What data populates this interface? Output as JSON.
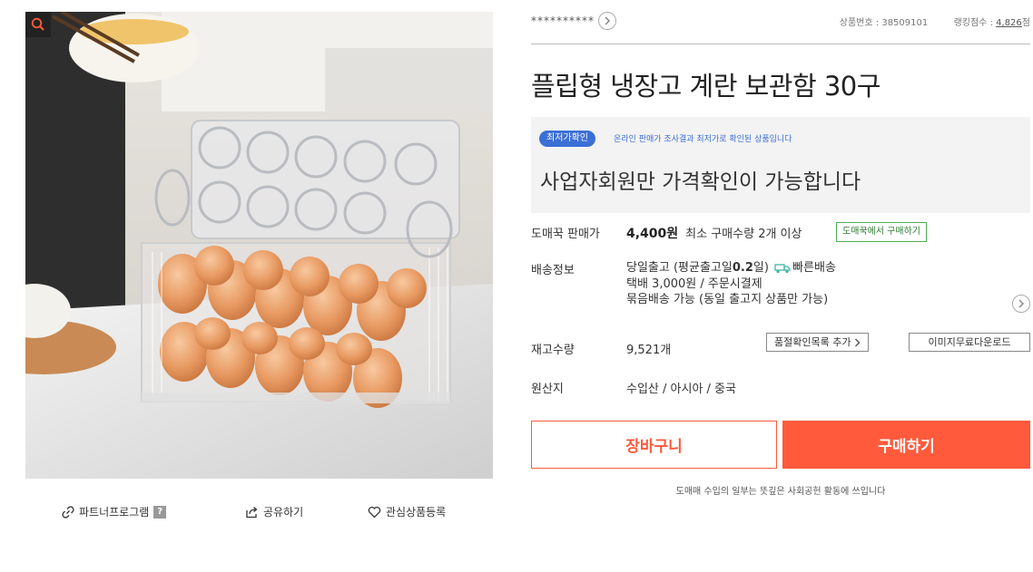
{
  "image": {
    "zoom_icon": "search-icon"
  },
  "image_actions": {
    "partner_label": "파트너프로그램",
    "partner_help": "?",
    "share_label": "공유하기",
    "wish_label": "관심상품등록"
  },
  "header": {
    "seller_name": "**********",
    "product_no_label": "상품번호 :",
    "product_no": "38509101",
    "ranking_label": "랭킹점수 :",
    "ranking_value": "4,826",
    "ranking_unit": "점"
  },
  "product": {
    "title": "플립형 냉장고 계란 보관함 30구"
  },
  "price_box": {
    "badge": "최저가확인",
    "note": "온라인 판매가 조사결과 최저가로 확인된 상품입니다",
    "business_only": "사업자회원만 가격확인이 가능합니다"
  },
  "details": {
    "wholesale_label": "도매꾹 판매가",
    "wholesale_price": "4,400원",
    "min_qty": "최소 구매수량 2개 이상",
    "buy_on_domeggook": "도매꾹에서 구매하기",
    "shipping_label": "배송정보",
    "shipping_line1_a": "당일출고 (평균출고일",
    "shipping_line1_b": "0.2",
    "shipping_line1_c": "일)",
    "shipping_fast": "빠른배송",
    "shipping_line2": "택배 3,000원 / 주문시결제",
    "shipping_line3": "묶음배송 가능 (동일 출고지 상품만 가능)",
    "stock_label": "재고수량",
    "stock_value": "9,521개",
    "soldout_button": "품절확인목록 추가",
    "image_download_button": "이미지무료다운로드",
    "origin_label": "원산지",
    "origin_value": "수입산 / 아시아 / 중국"
  },
  "actions": {
    "cart": "장바구니",
    "buy": "구매하기",
    "footnote": "도매매 수입의 일부는 뜻깊은 사회공헌 활동에 쓰입니다"
  },
  "colors": {
    "accent": "#ff5a3c",
    "badge_blue": "#3b6fd6",
    "green": "#4caf50"
  }
}
